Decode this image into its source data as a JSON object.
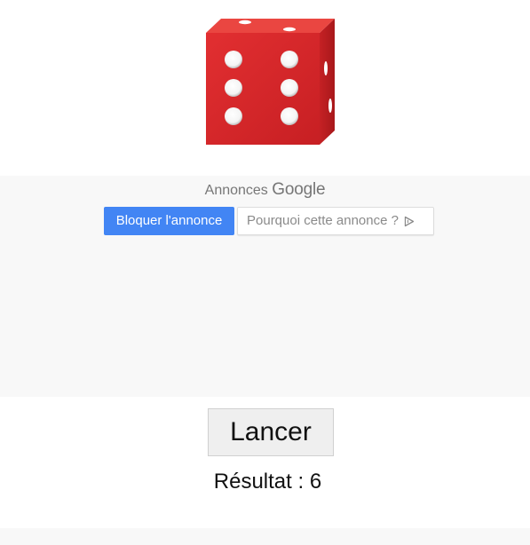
{
  "die": {
    "face_value": 6,
    "colors": {
      "front": "#d9282b",
      "top": "#e9443f",
      "side": "#b81d20",
      "pip": "#ffffff"
    }
  },
  "ad": {
    "label": "Annonces",
    "brand": "Google",
    "block_button_label": "Bloquer l'annonce",
    "why_button_label": "Pourquoi cette annonce ?",
    "block_button_color": "#4285f4"
  },
  "roll_button_label": "Lancer",
  "result": {
    "label": "Résultat",
    "separator": " : ",
    "value": "6"
  }
}
